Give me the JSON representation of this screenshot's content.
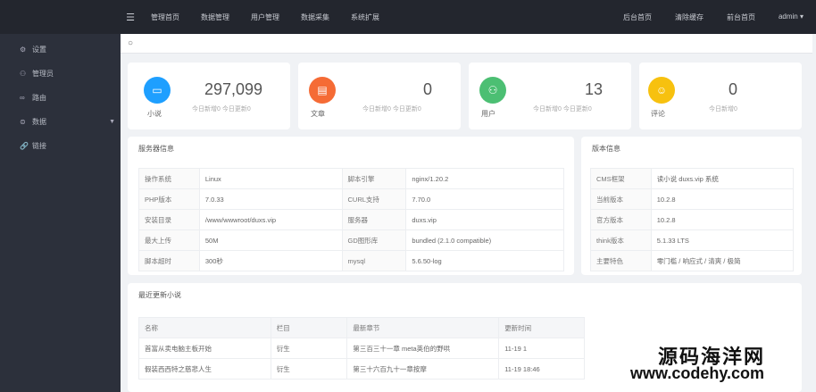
{
  "topbar": {
    "menu_icon": "hamburger-icon",
    "nav": [
      "管理首页",
      "数据管理",
      "用户管理",
      "数据采集",
      "系统扩展"
    ],
    "right": [
      "后台首页",
      "清除缓存",
      "前台首页",
      "admin ▾"
    ]
  },
  "sidebar": {
    "items": [
      {
        "icon": "gear-icon",
        "label": "设置"
      },
      {
        "icon": "user-icon",
        "label": "管理员"
      },
      {
        "icon": "route-icon",
        "label": "路由"
      },
      {
        "icon": "database-icon",
        "label": "数据"
      },
      {
        "icon": "link-icon",
        "label": "链接"
      }
    ]
  },
  "search": {
    "icon": "search-icon"
  },
  "stats": [
    {
      "label": "小说",
      "value": "297,099",
      "sub": "今日新增0 今日更新0",
      "color": "#1e9fff",
      "icon": "book-icon"
    },
    {
      "label": "文章",
      "value": "0",
      "sub": "今日新增0 今日更新0",
      "color": "#f56b35",
      "icon": "article-icon"
    },
    {
      "label": "用户",
      "value": "13",
      "sub": "今日新增0 今日更新0",
      "color": "#4cbf73",
      "icon": "user-icon"
    },
    {
      "label": "评论",
      "value": "0",
      "sub": "今日新增0",
      "color": "#f7c10f",
      "icon": "comment-icon"
    }
  ],
  "server": {
    "title": "服务器信息",
    "rows": [
      [
        "操作系统",
        "Linux",
        "脚本引擎",
        "nginx/1.20.2"
      ],
      [
        "PHP版本",
        "7.0.33",
        "CURL支持",
        "7.70.0"
      ],
      [
        "安装目录",
        "/www/wwwroot/duxs.vip",
        "服务器",
        "duxs.vip"
      ],
      [
        "最大上传",
        "50M",
        "GD图形库",
        "bundled (2.1.0 compatible)"
      ],
      [
        "脚本超时",
        "300秒",
        "mysql",
        "5.6.50-log"
      ]
    ]
  },
  "version": {
    "title": "版本信息",
    "rows": [
      [
        "CMS框架",
        "读小说 duxs.vip 系统"
      ],
      [
        "当前版本",
        "10.2.8"
      ],
      [
        "官方版本",
        "10.2.8"
      ],
      [
        "think版本",
        "5.1.33 LTS"
      ],
      [
        "主要特色",
        "零门槛 / 响应式 / 清爽 / 极简"
      ]
    ]
  },
  "recent": {
    "title": "最近更新小说",
    "headers": [
      "名称",
      "栏目",
      "最新章节",
      "更新时间"
    ],
    "rows": [
      [
        "首富从卖电脑主板开始",
        "衍生",
        "第三百三十一章 meta英伯的野哄",
        "11-19 1"
      ],
      [
        "假装西西特之慈悲人生",
        "衍生",
        "第三十六百九十一章按摩",
        "11-19 18:46"
      ]
    ]
  },
  "watermark": {
    "line1": "源码海洋网",
    "line2": "www.codehy.com"
  }
}
